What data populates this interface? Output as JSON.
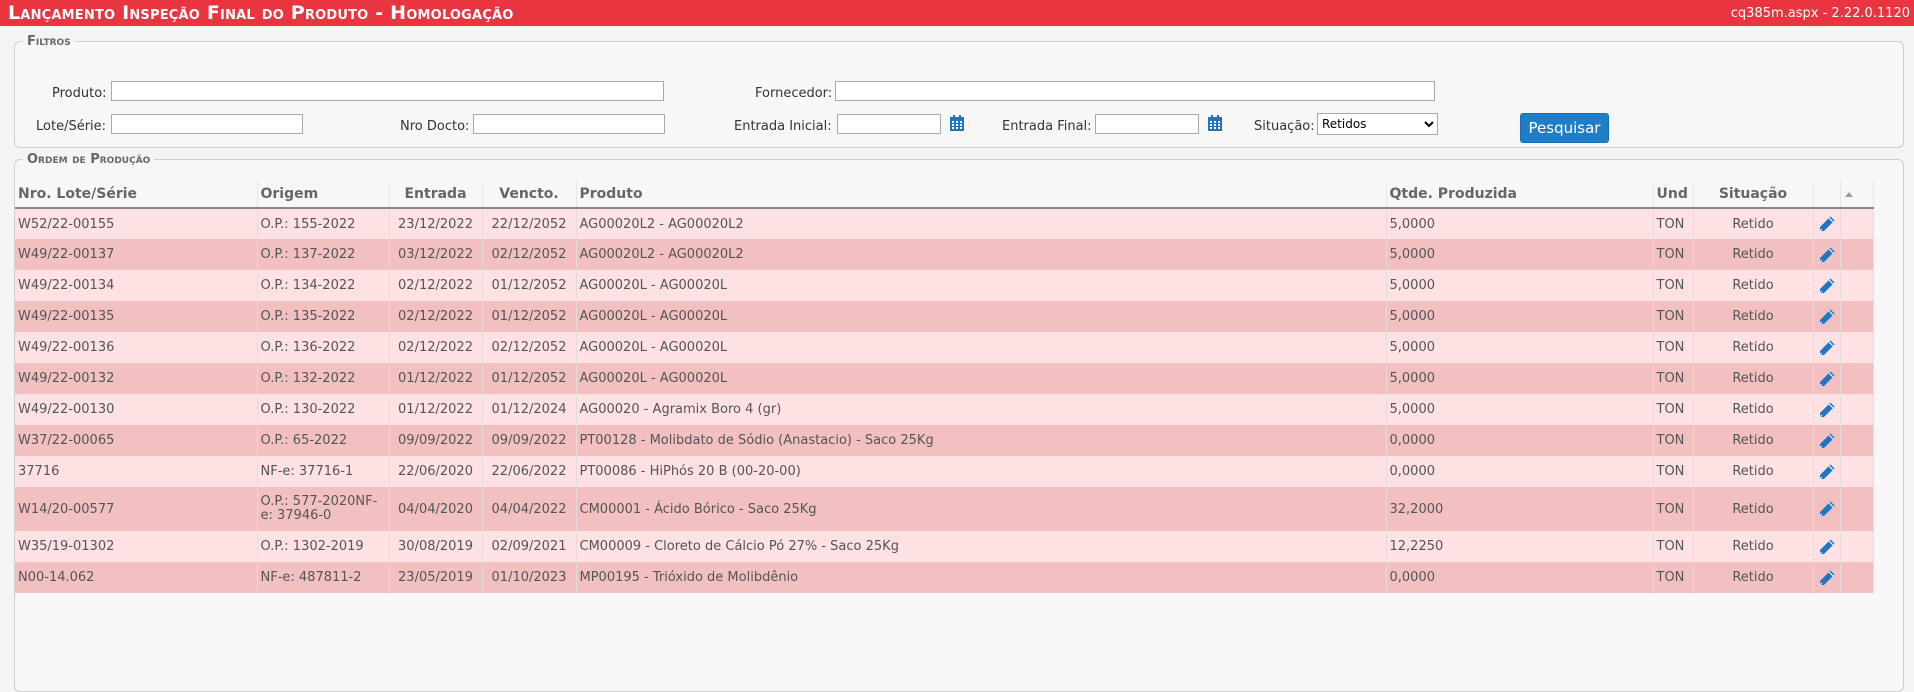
{
  "header": {
    "title": "Lançamento Inspeção Final do Produto  - Homologação",
    "version": "cq385m.aspx - 2.22.0.1120"
  },
  "filters": {
    "legend": "Filtros",
    "produto_label": "Produto:",
    "fornecedor_label": "Fornecedor:",
    "lote_label": "Lote/Série:",
    "nro_docto_label": "Nro Docto:",
    "entrada_inicial_label": "Entrada Inicial:",
    "entrada_final_label": "Entrada Final:",
    "situacao_label": "Situação:",
    "situacao_value": "Retidos",
    "search_label": "Pesquisar"
  },
  "orders": {
    "legend": "Ordem de Produção",
    "columns": {
      "lote": "Nro. Lote/Série",
      "origem": "Origem",
      "entrada": "Entrada",
      "vencto": "Vencto.",
      "produto": "Produto",
      "qtde": "Qtde. Produzida",
      "und": "Und",
      "situacao": "Situação"
    },
    "rows": [
      {
        "lote": "W52/22-00155",
        "origem": "O.P.: 155-2022",
        "entrada": "23/12/2022",
        "vencto": "22/12/2052",
        "produto": "AG00020L2 - AG00020L2",
        "qtde": "5,0000",
        "und": "TON",
        "situacao": "Retido"
      },
      {
        "lote": "W49/22-00137",
        "origem": "O.P.: 137-2022",
        "entrada": "03/12/2022",
        "vencto": "02/12/2052",
        "produto": "AG00020L2 - AG00020L2",
        "qtde": "5,0000",
        "und": "TON",
        "situacao": "Retido"
      },
      {
        "lote": "W49/22-00134",
        "origem": "O.P.: 134-2022",
        "entrada": "02/12/2022",
        "vencto": "01/12/2052",
        "produto": "AG00020L - AG00020L",
        "qtde": "5,0000",
        "und": "TON",
        "situacao": "Retido"
      },
      {
        "lote": "W49/22-00135",
        "origem": "O.P.: 135-2022",
        "entrada": "02/12/2022",
        "vencto": "01/12/2052",
        "produto": "AG00020L - AG00020L",
        "qtde": "5,0000",
        "und": "TON",
        "situacao": "Retido"
      },
      {
        "lote": "W49/22-00136",
        "origem": "O.P.: 136-2022",
        "entrada": "02/12/2022",
        "vencto": "02/12/2052",
        "produto": "AG00020L - AG00020L",
        "qtde": "5,0000",
        "und": "TON",
        "situacao": "Retido"
      },
      {
        "lote": "W49/22-00132",
        "origem": "O.P.: 132-2022",
        "entrada": "01/12/2022",
        "vencto": "01/12/2052",
        "produto": "AG00020L - AG00020L",
        "qtde": "5,0000",
        "und": "TON",
        "situacao": "Retido"
      },
      {
        "lote": "W49/22-00130",
        "origem": "O.P.: 130-2022",
        "entrada": "01/12/2022",
        "vencto": "01/12/2024",
        "produto": "AG00020 - Agramix Boro 4 (gr)",
        "qtde": "5,0000",
        "und": "TON",
        "situacao": "Retido"
      },
      {
        "lote": "W37/22-00065",
        "origem": "O.P.: 65-2022",
        "entrada": "09/09/2022",
        "vencto": "09/09/2022",
        "produto": "PT00128 - Molibdato de Sódio (Anastacio) - Saco 25Kg",
        "qtde": "0,0000",
        "und": "TON",
        "situacao": "Retido"
      },
      {
        "lote": "37716",
        "origem": "NF-e: 37716-1",
        "entrada": "22/06/2020",
        "vencto": "22/06/2022",
        "produto": "PT00086 - HiPhós 20 B (00-20-00)",
        "qtde": "0,0000",
        "und": "TON",
        "situacao": "Retido"
      },
      {
        "lote": "W14/20-00577",
        "origem": "O.P.: 577-2020NF-e: 37946-0",
        "entrada": "04/04/2020",
        "vencto": "04/04/2022",
        "produto": "CM00001 - Ácido Bórico - Saco 25Kg",
        "qtde": "32,2000",
        "und": "TON",
        "situacao": "Retido"
      },
      {
        "lote": "W35/19-01302",
        "origem": "O.P.: 1302-2019",
        "entrada": "30/08/2019",
        "vencto": "02/09/2021",
        "produto": "CM00009 - Cloreto de Cálcio Pó 27% - Saco 25Kg",
        "qtde": "12,2250",
        "und": "TON",
        "situacao": "Retido"
      },
      {
        "lote": "N00-14.062",
        "origem": "NF-e: 487811-2",
        "entrada": "23/05/2019",
        "vencto": "01/10/2023",
        "produto": "MP00195 - Trióxido de Molibdênio",
        "qtde": "0,0000",
        "und": "TON",
        "situacao": "Retido"
      }
    ]
  },
  "colors": {
    "header_bg": "#e8353f",
    "row_light": "#fde1e3",
    "row_dark": "#f2c0c1",
    "button": "#1e7ec8",
    "icon": "#1f75c4"
  }
}
